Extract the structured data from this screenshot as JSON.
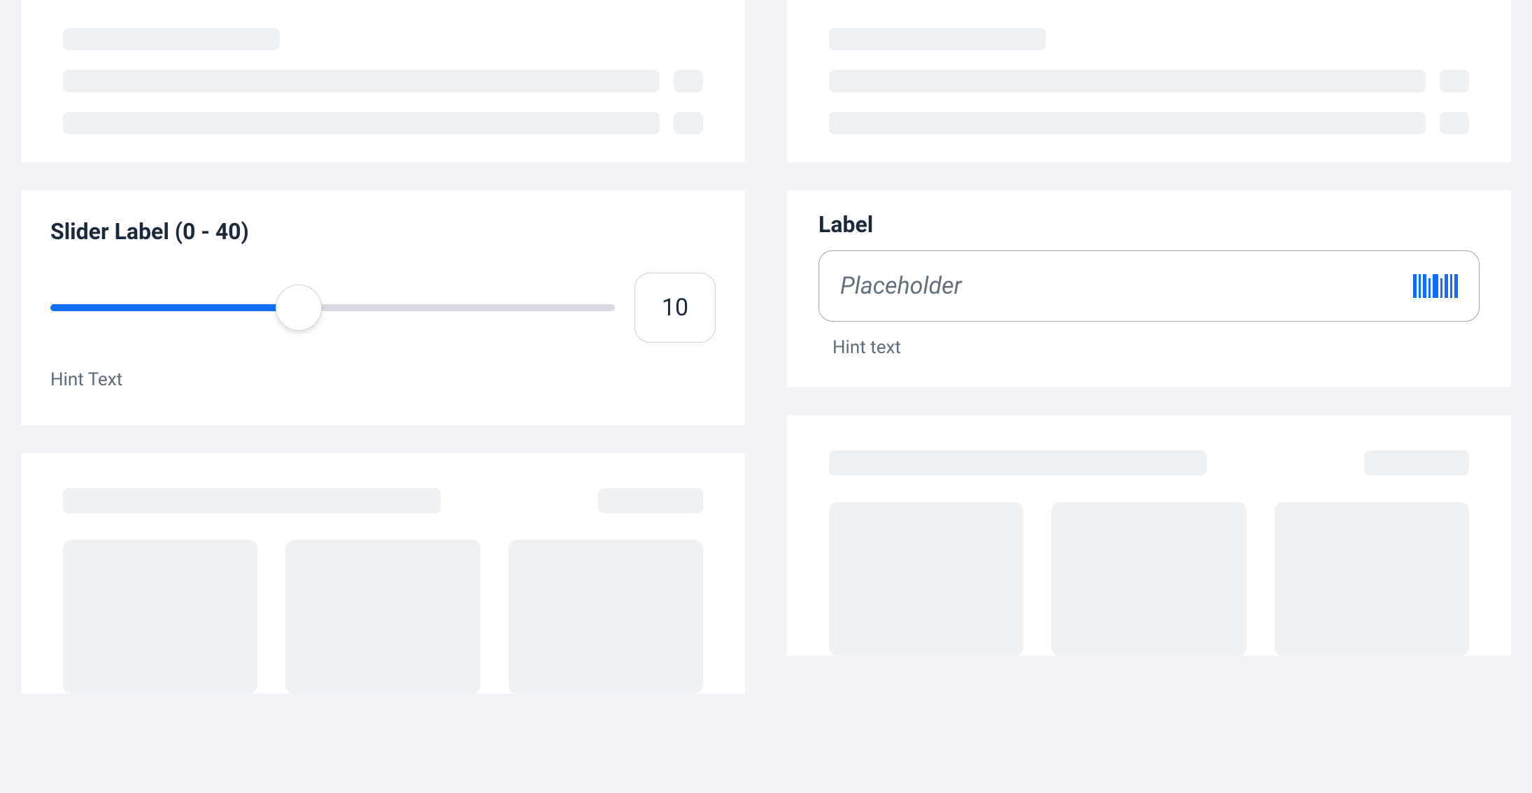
{
  "slider": {
    "label": "Slider Label (0 - 40)",
    "min": 0,
    "max": 40,
    "value": 10,
    "percent": 44,
    "hint": "Hint Text"
  },
  "input": {
    "label": "Label",
    "placeholder": "Placeholder",
    "hint": "Hint text",
    "icon": "barcode-icon"
  },
  "colors": {
    "accent": "#0d6efd",
    "skeleton": "#eef1f4"
  }
}
